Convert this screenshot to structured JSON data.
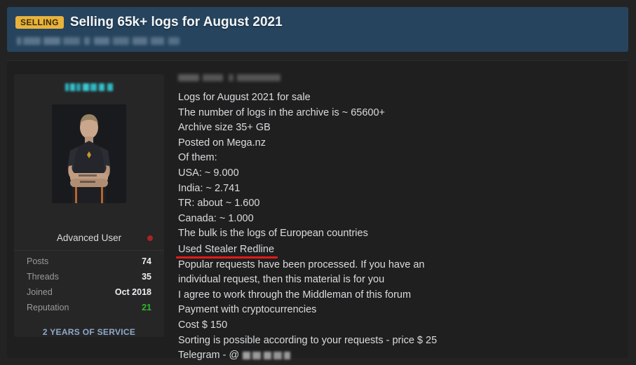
{
  "header": {
    "prefix_badge": "SELLING",
    "title": "Selling 65k+ logs for August 2021",
    "subtitle_redacted": true,
    "banner_color": "#26445e",
    "badge_color": "#e8b33c"
  },
  "user_card": {
    "username_redacted": true,
    "username_blur_color": "#30b9c5",
    "avatar": "user-avatar-photo",
    "rank": "Advanced User",
    "status_dot_color": "#a82424",
    "stats": [
      {
        "label": "Posts",
        "value": "74",
        "highlight": false
      },
      {
        "label": "Threads",
        "value": "35",
        "highlight": false
      },
      {
        "label": "Joined",
        "value": "Oct 2018",
        "highlight": false
      },
      {
        "label": "Reputation",
        "value": "21",
        "highlight": true
      }
    ],
    "reputation_color": "#2eb82e",
    "service_badge": "2 YEARS OF SERVICE",
    "service_badge_color": "#8fa9cc"
  },
  "post": {
    "meta_redacted": true,
    "lines": [
      {
        "text": "Logs for August 2021 for sale",
        "annotated": false
      },
      {
        "text": "The number of logs in the archive is ~ 65600+",
        "annotated": false
      },
      {
        "text": "Archive size 35+ GB",
        "annotated": false
      },
      {
        "text": "Posted on Mega.nz",
        "annotated": false
      },
      {
        "text": "Of them:",
        "annotated": false
      },
      {
        "text": "USA:  ~ 9.000",
        "annotated": false
      },
      {
        "text": "India: ~ 2.741",
        "annotated": false
      },
      {
        "text": "TR: about ~ 1.600",
        "annotated": false
      },
      {
        "text": "Canada: ~ 1.000",
        "annotated": false
      },
      {
        "text": "The bulk is the logs of European countries",
        "annotated": false
      },
      {
        "text": "Used Stealer Redline",
        "annotated": true
      },
      {
        "text": "Popular requests have been processed. If you have an individual request, then this material is for you",
        "annotated": false,
        "wrapped": true
      },
      {
        "text": "I agree to work through the Middleman of this forum",
        "annotated": false
      },
      {
        "text": "Payment with cryptocurrencies",
        "annotated": false
      },
      {
        "text": "Cost $ 150",
        "annotated": false
      },
      {
        "text": "Sorting is possible according to your requests - price $ 25",
        "annotated": false
      }
    ],
    "telegram_label": "Telegram - @",
    "telegram_handle_redacted": true,
    "annotation_color": "#e21b1b"
  }
}
